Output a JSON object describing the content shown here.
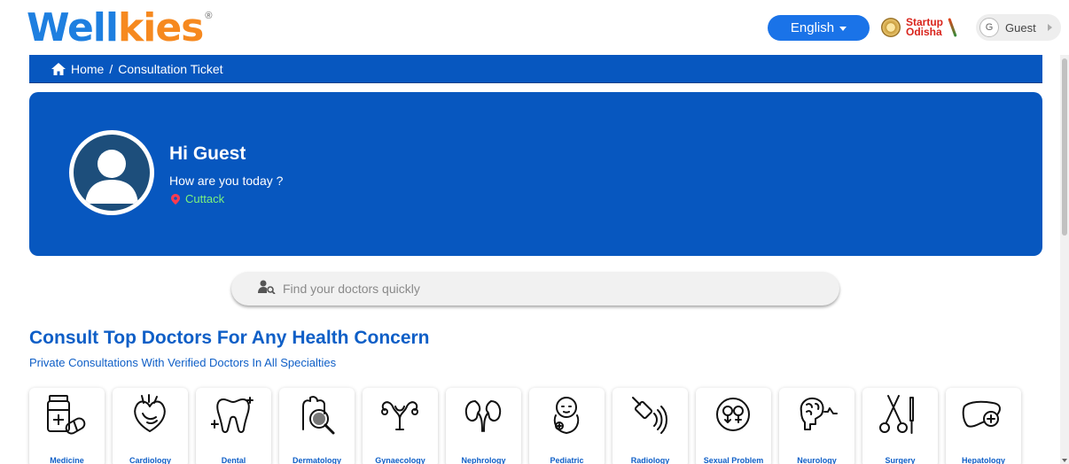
{
  "header": {
    "logo_part1": "Well",
    "logo_part2": "kies",
    "logo_reg": "®",
    "language_label": "English",
    "partner_line1": "Startup",
    "partner_line2": "Odisha",
    "user_initial": "G",
    "user_label": "Guest"
  },
  "breadcrumb": {
    "home": "Home",
    "separator": "/",
    "current": "Consultation Ticket"
  },
  "hero": {
    "greeting": "Hi Guest",
    "subtitle": "How are you today ?",
    "location": "Cuttack"
  },
  "search": {
    "placeholder": "Find your doctors quickly"
  },
  "section": {
    "title": "Consult Top Doctors For Any Health Concern",
    "subtitle": "Private Consultations With Verified Doctors In All Specialties"
  },
  "specialties": [
    {
      "label": "Medicine",
      "icon": "medicine-icon"
    },
    {
      "label": "Cardiology",
      "icon": "heart-icon"
    },
    {
      "label": "Dental",
      "icon": "tooth-icon"
    },
    {
      "label": "Dermatology",
      "icon": "skin-magnifier-icon"
    },
    {
      "label": "Gynaecology",
      "icon": "uterus-icon"
    },
    {
      "label": "Nephrology",
      "icon": "kidney-icon"
    },
    {
      "label": "Pediatric",
      "icon": "baby-icon"
    },
    {
      "label": "Radiology",
      "icon": "scanner-icon"
    },
    {
      "label": "Sexual Problem",
      "icon": "gender-icon"
    },
    {
      "label": "Neurology",
      "icon": "brain-icon"
    },
    {
      "label": "Surgery",
      "icon": "scissors-icon"
    },
    {
      "label": "Hepatology",
      "icon": "liver-icon"
    }
  ],
  "colors": {
    "brand_blue": "#0757bf",
    "logo_blue": "#1e7fe0",
    "logo_orange": "#f6891f",
    "location_green": "#7cf27c"
  }
}
